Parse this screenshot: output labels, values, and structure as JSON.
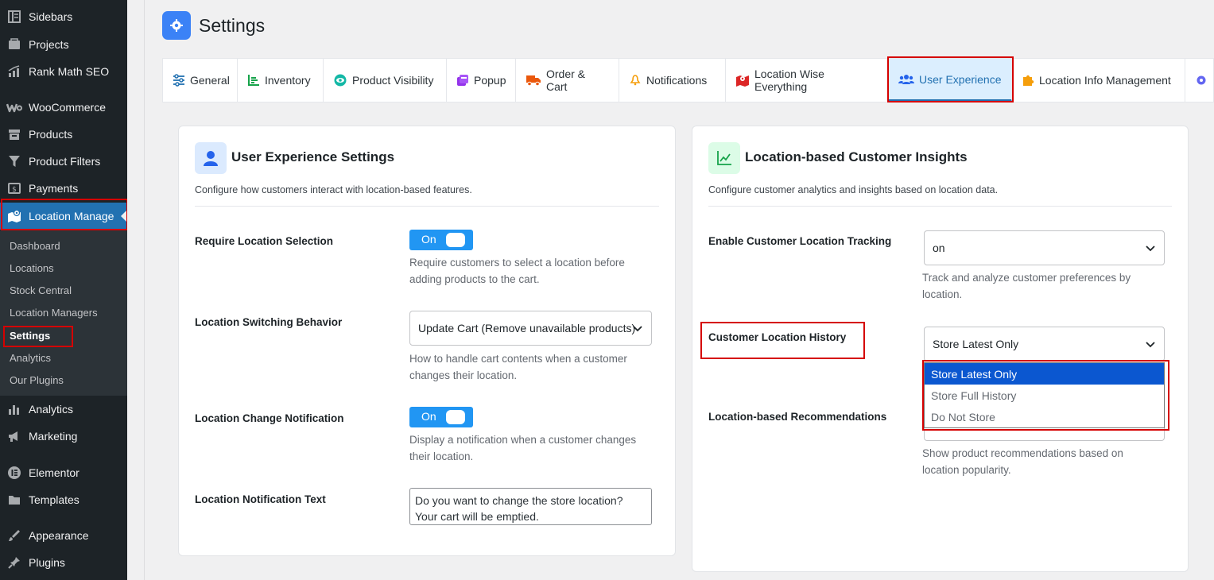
{
  "sidebar": {
    "items": [
      {
        "label": "Sidebars",
        "icon": "sidebars-icon"
      },
      {
        "label": "Projects",
        "icon": "projects-icon"
      },
      {
        "label": "Rank Math SEO",
        "icon": "rank-math-icon"
      },
      {
        "label": "WooCommerce",
        "icon": "woocommerce-icon"
      },
      {
        "label": "Products",
        "icon": "products-icon"
      },
      {
        "label": "Product Filters",
        "icon": "filter-icon"
      },
      {
        "label": "Payments",
        "icon": "payments-icon"
      },
      {
        "label": "Location Manage",
        "icon": "location-map-icon"
      },
      {
        "label": "Analytics",
        "icon": "analytics-icon"
      },
      {
        "label": "Marketing",
        "icon": "marketing-icon"
      },
      {
        "label": "Elementor",
        "icon": "elementor-icon"
      },
      {
        "label": "Templates",
        "icon": "templates-icon"
      },
      {
        "label": "Appearance",
        "icon": "appearance-icon"
      },
      {
        "label": "Plugins",
        "icon": "plugins-icon"
      }
    ],
    "submenu": [
      "Dashboard",
      "Locations",
      "Stock Central",
      "Location Managers",
      "Settings",
      "Analytics",
      "Our Plugins"
    ]
  },
  "header": {
    "title": "Settings",
    "icon": "gear-icon"
  },
  "tabs": [
    {
      "label": "General",
      "icon": "sliders-icon"
    },
    {
      "label": "Inventory",
      "icon": "inventory-chart-icon"
    },
    {
      "label": "Product Visibility",
      "icon": "eye-icon"
    },
    {
      "label": "Popup",
      "icon": "popup-icon"
    },
    {
      "label": "Order & Cart",
      "icon": "truck-icon"
    },
    {
      "label": "Notifications",
      "icon": "bell-icon"
    },
    {
      "label": "Location Wise Everything",
      "icon": "map-icon"
    },
    {
      "label": "User Experience",
      "icon": "users-icon"
    },
    {
      "label": "Location Info Management",
      "icon": "puzzle-icon"
    }
  ],
  "ux_card": {
    "title": "User Experience Settings",
    "description": "Configure how customers interact with location-based features.",
    "fields": {
      "require_selection": {
        "label": "Require Location Selection",
        "toggle": "On",
        "help1": "Require customers to select a location before",
        "help2": "adding products to the cart."
      },
      "switching": {
        "label": "Location Switching Behavior",
        "value": "Update Cart (Remove unavailable products)",
        "help1": "How to handle cart contents when a customer",
        "help2": "changes their location."
      },
      "change_notification": {
        "label": "Location Change Notification",
        "toggle": "On",
        "help1": "Display a notification when a customer changes",
        "help2": "their location."
      },
      "notification_text": {
        "label": "Location Notification Text",
        "line1": "Do you want to change the store location?",
        "line2": "Your cart will be emptied."
      }
    }
  },
  "insights_card": {
    "title": "Location-based Customer Insights",
    "description": "Configure customer analytics and insights based on location data.",
    "fields": {
      "tracking": {
        "label": "Enable Customer Location Tracking",
        "value": "on",
        "help1": "Track and analyze customer preferences by",
        "help2": "location."
      },
      "history": {
        "label": "Customer Location History",
        "value": "Store Latest Only",
        "options": [
          "Store Latest Only",
          "Store Full History",
          "Do Not Store"
        ]
      },
      "recommendations": {
        "label": "Location-based Recommendations",
        "help1": "Show product recommendations based on",
        "help2": "location popularity."
      }
    }
  },
  "colors": {
    "sidebar_bg": "#1d2327",
    "accent": "#2271b1",
    "toggle": "#2196f3",
    "highlight": "#d50000"
  }
}
